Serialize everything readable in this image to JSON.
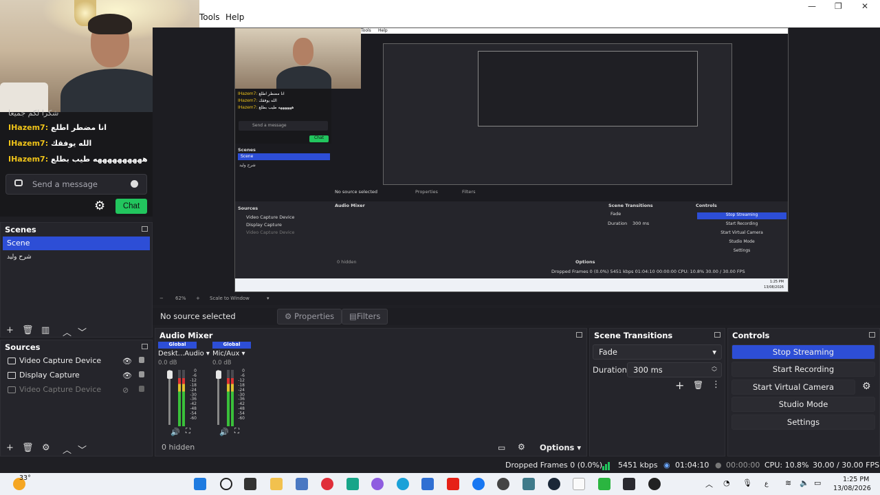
{
  "menu": {
    "tools": "Tools",
    "help": "Help"
  },
  "window_controls": {
    "minimize": "—",
    "maximize": "❐",
    "close": "✕"
  },
  "chat": {
    "cut_line": "شكرا لكم جميعا",
    "messages": [
      {
        "user": "IHazem7:",
        "text": "انا مضطر اطلع"
      },
      {
        "user": "IHazem7:",
        "text": "الله يوفقك"
      },
      {
        "user": "IHazem7:",
        "text": "ههههههههههه طيب بطلع"
      }
    ],
    "input_placeholder": "Send a message",
    "send_button": "Chat"
  },
  "nested_preview": {
    "menu_tools": "Tools",
    "menu_help": "Help",
    "chat_messages": [
      {
        "user": "IHazem7:",
        "text": "انا مضطر اطلع"
      },
      {
        "user": "IHazem7:",
        "text": "الله يوفقك"
      },
      {
        "user": "IHazem7:",
        "text": "هههههههه طيب بطلع"
      }
    ],
    "chat_placeholder": "Send a message",
    "chat_button": "Chat",
    "scenes_title": "Scenes",
    "scene_selected": "Scene",
    "scene_other": "شرح وليد",
    "sources_title": "Sources",
    "sources": [
      "Video Capture Device",
      "Display Capture",
      "Video Capture Device"
    ],
    "audio_mixer_title": "Audio Mixer",
    "no_source": "No source selected",
    "properties": "Properties",
    "filters": "Filters",
    "transitions_title": "Scene Transitions",
    "fade": "Fade",
    "duration_label": "Duration",
    "duration_value": "300 ms",
    "controls_title": "Controls",
    "controls": [
      "Stop Streaming",
      "Start Recording",
      "Start Virtual Camera",
      "Studio Mode",
      "Settings"
    ],
    "hidden": "0 hidden",
    "options": "Options",
    "status": "Dropped Frames 0 (0.0%)   5451 kbps   01:04:10   00:00:00   CPU: 10.8%   30.00 / 30.00 FPS",
    "clock_time": "1:25 PM",
    "clock_date": "13/08/2026"
  },
  "scenebar": {
    "zoom": "62%",
    "scale_mode": "Scale to Window"
  },
  "context_bar": {
    "no_source": "No source selected",
    "properties": "Properties",
    "filters": "Filters"
  },
  "scenes": {
    "title": "Scenes",
    "items": [
      {
        "label": "Scene",
        "selected": true
      },
      {
        "label": "شرح وليد",
        "selected": false
      }
    ]
  },
  "sources": {
    "title": "Sources",
    "items": [
      {
        "label": "Video Capture Device",
        "visible": true,
        "icon": "camera-icon"
      },
      {
        "label": "Display Capture",
        "visible": true,
        "icon": "monitor-icon"
      },
      {
        "label": "Video Capture Device",
        "visible": false,
        "icon": "camera-icon"
      }
    ]
  },
  "audio_mixer": {
    "title": "Audio Mixer",
    "channels": [
      {
        "badge": "Global",
        "name": "Deskt...Audio",
        "db": "0.0 dB",
        "level": 0.85
      },
      {
        "badge": "Global",
        "name": "Mic/Aux",
        "db": "0.0 dB",
        "level": 0.85
      }
    ],
    "scale": [
      "0",
      "-6",
      "-12",
      "-18",
      "-24",
      "-30",
      "-36",
      "-42",
      "-48",
      "-54",
      "-60"
    ],
    "hidden_label": "0 hidden",
    "options": "Options"
  },
  "transitions": {
    "title": "Scene Transitions",
    "selected": "Fade",
    "duration_label": "Duration",
    "duration_value": "300 ms"
  },
  "controls": {
    "title": "Controls",
    "stop_streaming": "Stop Streaming",
    "start_recording": "Start Recording",
    "start_virtual_camera": "Start Virtual Camera",
    "studio_mode": "Studio Mode",
    "settings": "Settings"
  },
  "status": {
    "dropped_frames": "Dropped Frames 0 (0.0%)",
    "bitrate": "5451 kbps",
    "stream_time": "01:04:10",
    "record_time": "00:00:00",
    "cpu": "CPU: 10.8%",
    "fps": "30.00 / 30.00 FPS"
  },
  "taskbar": {
    "weather": "33°",
    "time": "1:25 PM",
    "date": "13/08/2026"
  },
  "colors": {
    "accent": "#2d4ed6",
    "chat_button": "#22c55e",
    "username": "#f0c419",
    "panel_bg": "#25252b"
  }
}
